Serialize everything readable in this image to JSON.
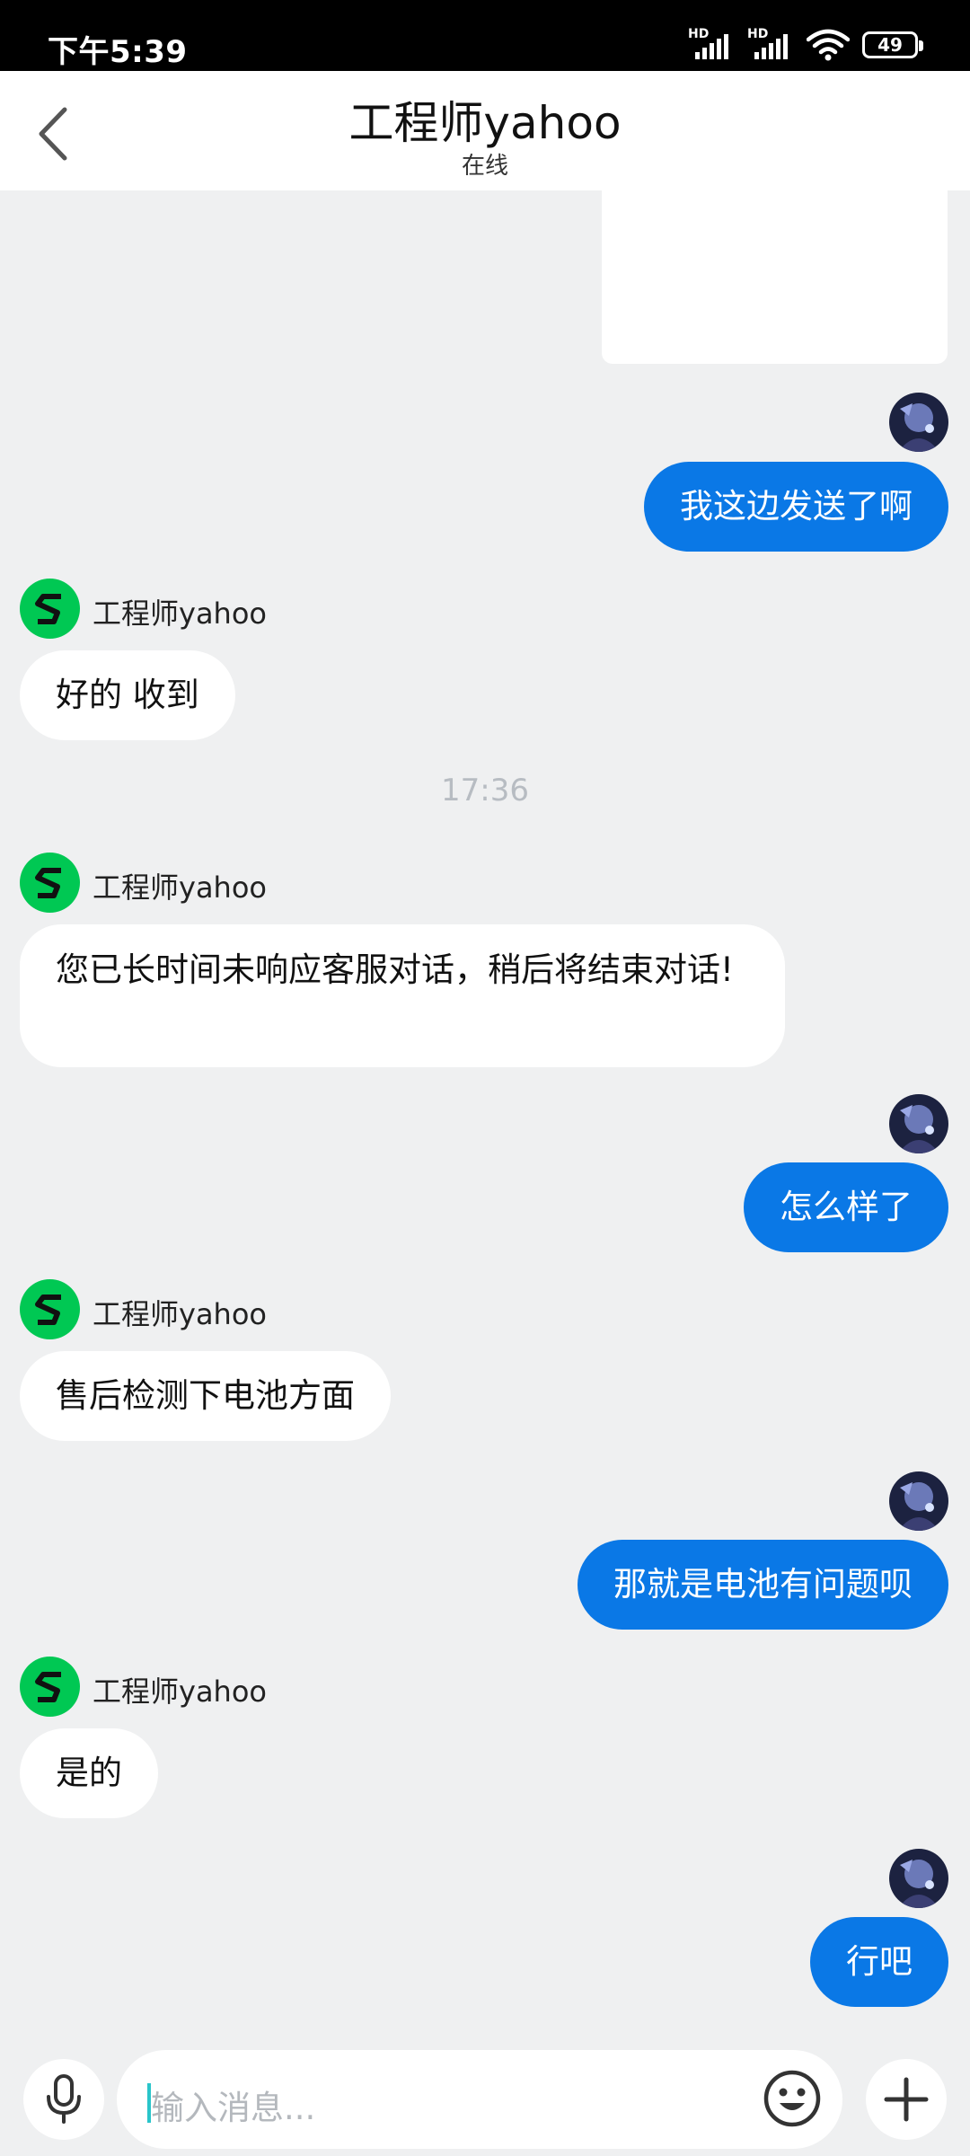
{
  "status_bar": {
    "time": "下午5:39",
    "sim1_label": "HD",
    "sim2_label": "HD",
    "battery": "49"
  },
  "header": {
    "title": "工程师yahoo",
    "subtitle": "在线"
  },
  "messages": {
    "m1": {
      "text": "我这边发送了啊"
    },
    "m2": {
      "sender": "工程师yahoo",
      "text": "好的 收到"
    },
    "timestamp": "17:36",
    "m3": {
      "sender": "工程师yahoo",
      "text": "您已长时间未响应客服对话，稍后将结束对话!"
    },
    "m4": {
      "text": "怎么样了"
    },
    "m5": {
      "sender": "工程师yahoo",
      "text": "售后检测下电池方面"
    },
    "m6": {
      "text": "那就是电池有问题呗"
    },
    "m7": {
      "sender": "工程师yahoo",
      "text": "是的"
    },
    "m8": {
      "text": "行吧"
    }
  },
  "input": {
    "placeholder": "输入消息..."
  },
  "colors": {
    "self_bubble": "#0a78e6",
    "bot_avatar": "#00c853",
    "background": "#eff0f1"
  },
  "icons": {
    "back": "chevron-left-icon",
    "mic": "microphone-icon",
    "emoji": "smiley-icon",
    "plus": "plus-icon",
    "bot_logo": "s-logo-icon"
  }
}
